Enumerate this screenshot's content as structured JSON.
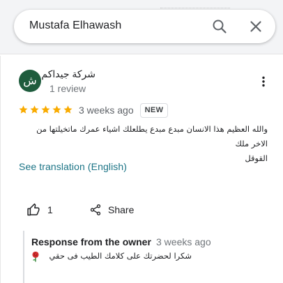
{
  "search": {
    "query": "Mustafa Elhawash",
    "search_icon": "search-icon",
    "close_icon": "close-icon"
  },
  "review": {
    "avatar_letter": "ش",
    "avatar_color": "#1e5c3d",
    "reviewer_name": "شركة جيداكم",
    "review_count": "1 review",
    "rating": 5,
    "date": "3 weeks ago",
    "badge": "NEW",
    "text_line_1": "والله العظيم هذا الانسان مبدع مبدع يطلعلك اشياء عمرك ماتخيلتها من الاخر ملك",
    "text_line_2": "القوقل",
    "translate_link": "See translation (English)",
    "like_count": "1",
    "share_label": "Share"
  },
  "owner_response": {
    "title": "Response from the owner",
    "date": "3 weeks ago",
    "text": "شكرا لحضرتك على كلامك الطيب فى حقي"
  },
  "colors": {
    "star": "#f9ab00",
    "link": "#1a7385",
    "topbar_bg": "#f3f4f6"
  }
}
